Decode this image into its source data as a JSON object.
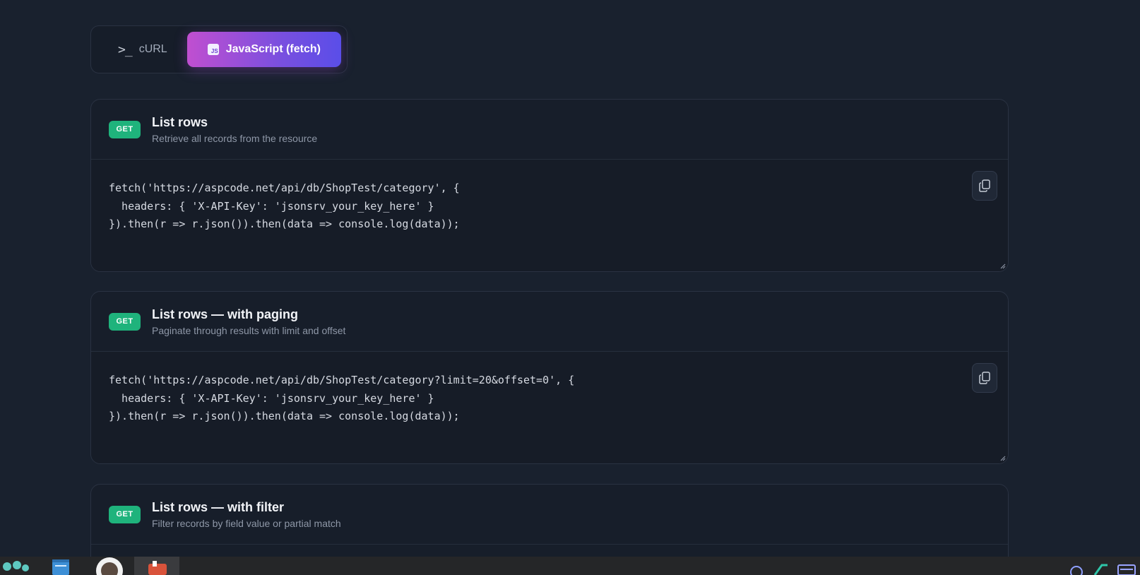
{
  "tabs": [
    {
      "label": "cURL",
      "icon": "terminal-icon",
      "active": false
    },
    {
      "label": "JavaScript (fetch)",
      "icon": "js-file-icon",
      "badge": "JS",
      "active": true
    }
  ],
  "endpoints": [
    {
      "method": "GET",
      "title": "List rows",
      "subtitle": "Retrieve all records from the resource",
      "code": "fetch('https://aspcode.net/api/db/ShopTest/category', {\n  headers: { 'X-API-Key': 'jsonsrv_your_key_here' }\n}).then(r => r.json()).then(data => console.log(data));"
    },
    {
      "method": "GET",
      "title": "List rows — with paging",
      "subtitle": "Paginate through results with limit and offset",
      "code": "fetch('https://aspcode.net/api/db/ShopTest/category?limit=20&offset=0', {\n  headers: { 'X-API-Key': 'jsonsrv_your_key_here' }\n}).then(r => r.json()).then(data => console.log(data));"
    },
    {
      "method": "GET",
      "title": "List rows — with filter",
      "subtitle": "Filter records by field value or partial match"
    }
  ],
  "colors": {
    "background": "#19212e",
    "card": "#171e2a",
    "method_get": "#1fb37c",
    "tab_active_gradient_start": "#c04fd0",
    "tab_active_gradient_end": "#5a4ee8"
  }
}
